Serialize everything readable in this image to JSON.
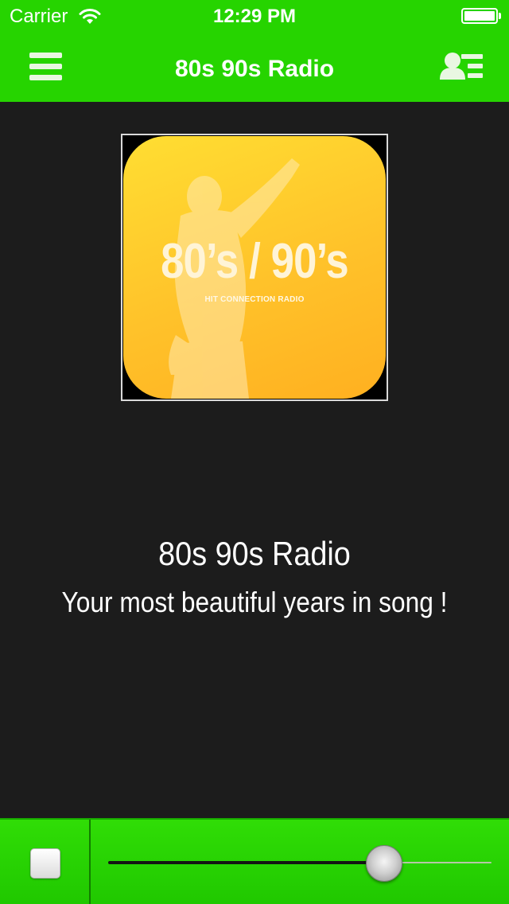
{
  "status_bar": {
    "carrier": "Carrier",
    "time": "12:29 PM",
    "wifi_icon": "wifi-icon",
    "battery_icon": "battery-icon"
  },
  "nav_bar": {
    "title": "80s 90s Radio",
    "menu_icon": "hamburger-menu-icon",
    "right_icon": "contact-list-icon",
    "background_color": "#26d400"
  },
  "artwork": {
    "headline": "80’s / 90’s",
    "subtitle": "HIT CONNECTION RADIO"
  },
  "station": {
    "name": "80s 90s Radio",
    "slogan": "Your most beautiful years in song !"
  },
  "player": {
    "stop_icon": "stop-icon",
    "volume_level": 0.72
  }
}
